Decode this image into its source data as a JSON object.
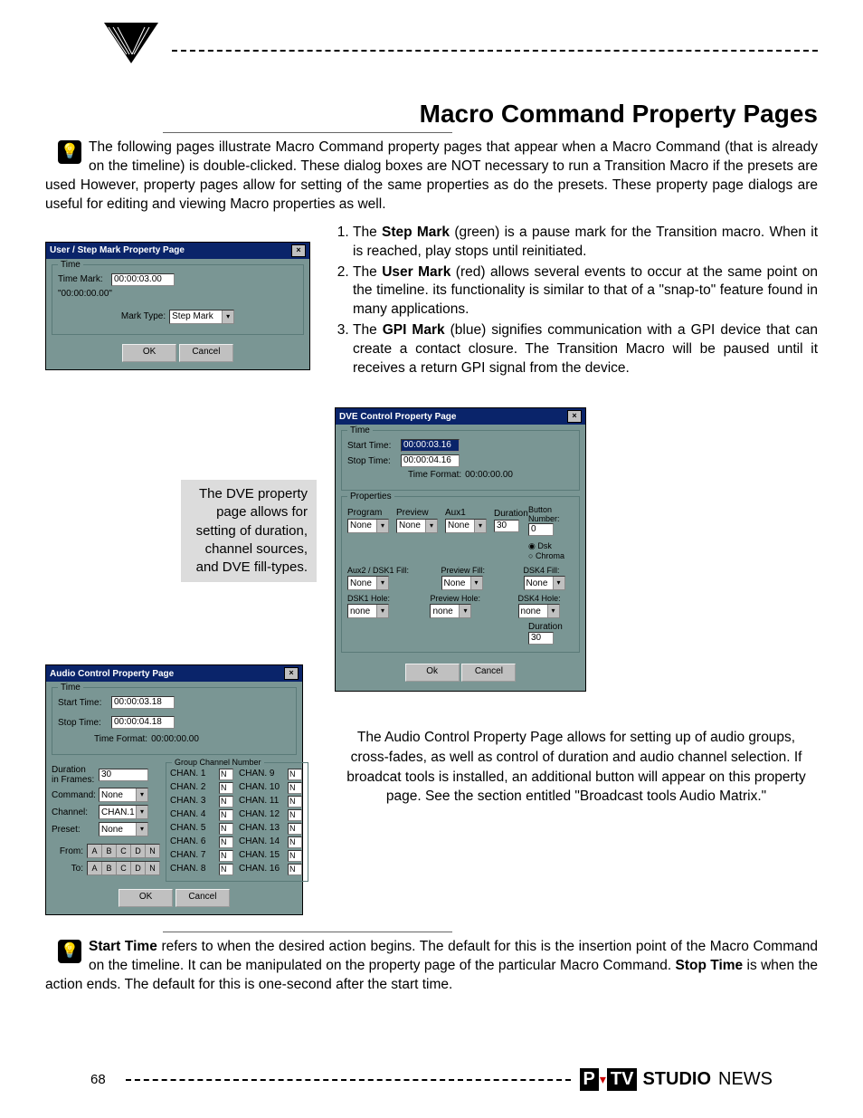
{
  "page_number": "68",
  "title": "Macro Command Property Pages",
  "intro_text": "The following pages illustrate Macro Command property pages that appear when a Macro Command (that is already on the timeline) is double-clicked.  These dialog boxes are NOT necessary to run a Transition Macro if the presets are used However, property pages allow for setting of the same properties as do the presets.  These property page dialogs are useful for editing and viewing Macro properties as well.",
  "marks": [
    {
      "pre": "The ",
      "bold": "Step Mark",
      "post": " (green) is a pause mark for the Transition macro.  When it is reached, play stops until reinitiated."
    },
    {
      "pre": "The ",
      "bold": "User Mark",
      "post": " (red) allows several events to occur at the same point on the timeline.  its functionality is similar to that of a \"snap-to\" feature found in many applications."
    },
    {
      "pre": "The ",
      "bold": "GPI Mark",
      "post": " (blue) signifies communication with a GPI device that can create a contact closure.  The Transition Macro will be paused until it receives a return GPI signal from the device."
    }
  ],
  "dve_caption": "The DVE property page allows for setting of duration, channel sources, and DVE fill-types.",
  "audio_caption": "The Audio Control Property Page allows for setting up of audio groups, cross-fades, as well as control of duration and audio channel selection.  If broadcat tools is installed, an additional button will appear on this property page.  See the section entitled \"Broadcast tools Audio Matrix.\"",
  "bottom_note": {
    "b1": "Start Time",
    "t1": " refers to when the desired action begins.  The default for this is the insertion point of the Macro Command on the timeline.  It can be manipulated on the property page of the particular Macro Command.  ",
    "b2": "Stop Time",
    "t2": " is when the action ends.  The default for this is one-second after the start time."
  },
  "dlg_user": {
    "title": "User / Step Mark Property Page",
    "time_label": "Time",
    "time_mark_label": "Time Mark:",
    "time_mark_value": "00:00:03.00",
    "time_format": "\"00:00:00.00\"",
    "mark_type_label": "Mark Type:",
    "mark_type_value": "Step Mark",
    "ok": "OK",
    "cancel": "Cancel"
  },
  "dlg_dve": {
    "title": "DVE Control Property Page",
    "time_label": "Time",
    "start_label": "Start Time:",
    "start_value": "00:00:03.16",
    "stop_label": "Stop Time:",
    "stop_value": "00:00:04.16",
    "time_format_label": "Time Format:",
    "time_format_value": "00:00:00.00",
    "props_label": "Properties",
    "program_label": "Program",
    "preview_label": "Preview",
    "aux1_label": "Aux1",
    "duration_label": "Duration",
    "button_num_label": "Button Number:",
    "none": "None",
    "none_lc": "none",
    "duration_value": "30",
    "button_num_value": "0",
    "dsk_label": "Dsk",
    "chroma_label": "Chroma",
    "aux2_label": "Aux2 / DSK1 Fill:",
    "preview_fill_label": "Preview Fill:",
    "dsk4fill_label": "DSK4 Fill:",
    "dsk1hole_label": "DSK1 Hole:",
    "preview_hole_label": "Preview Hole:",
    "dsk4hole_label": "DSK4 Hole:",
    "duration2_label": "Duration",
    "duration2_value": "30",
    "ok": "Ok",
    "cancel": "Cancel"
  },
  "dlg_audio": {
    "title": "Audio Control Property Page",
    "time_label": "Time",
    "start_label": "Start Time:",
    "start_value": "00:00:03.18",
    "stop_label": "Stop Time:",
    "stop_value": "00:00:04.18",
    "time_format_label": "Time Format:",
    "time_format_value": "00:00:00.00",
    "duration_label": "Duration in Frames:",
    "duration_value": "30",
    "command_label": "Command:",
    "command_value": "None",
    "channel_label": "Channel:",
    "channel_value": "CHAN.1",
    "preset_label": "Preset:",
    "preset_value": "None",
    "from_label": "From:",
    "to_label": "To:",
    "toggles": [
      "A",
      "B",
      "C",
      "D",
      "N"
    ],
    "group_label": "Group Channel Number",
    "channels_left": [
      "CHAN. 1",
      "CHAN. 2",
      "CHAN. 3",
      "CHAN. 4",
      "CHAN. 5",
      "CHAN. 6",
      "CHAN. 7",
      "CHAN. 8"
    ],
    "channels_right": [
      "CHAN. 9",
      "CHAN. 10",
      "CHAN. 11",
      "CHAN. 12",
      "CHAN. 13",
      "CHAN. 14",
      "CHAN. 15",
      "CHAN. 16"
    ],
    "chan_val": "N",
    "ok": "OK",
    "cancel": "Cancel"
  },
  "footer_brand": {
    "p": "P",
    "tv": "TV",
    "studio": "STUDIO",
    "news": "NEWS"
  }
}
